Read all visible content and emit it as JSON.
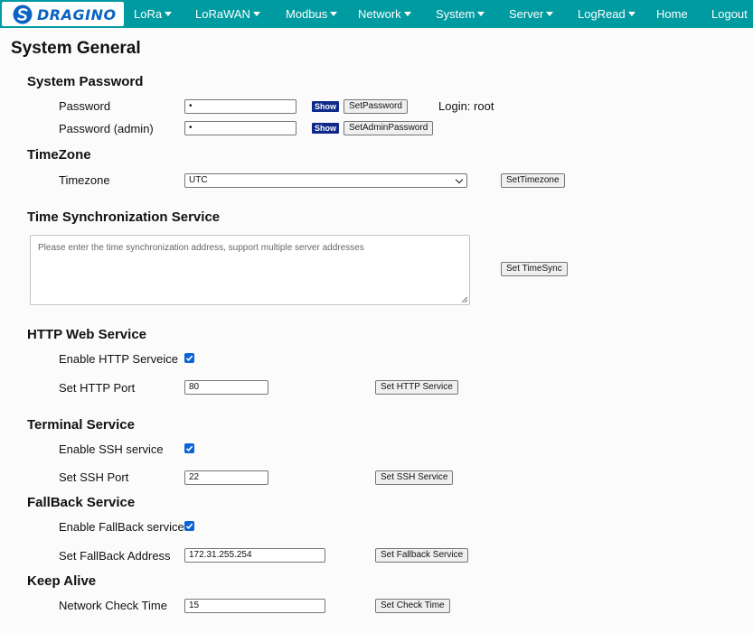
{
  "nav": {
    "logo_text": "DRAGINO",
    "items": [
      {
        "label": "LoRa",
        "dropdown": true
      },
      {
        "label": "LoRaWAN",
        "dropdown": true
      },
      {
        "label": "Modbus",
        "dropdown": true
      },
      {
        "label": "Network",
        "dropdown": true
      },
      {
        "label": "System",
        "dropdown": true
      },
      {
        "label": "Server",
        "dropdown": true
      },
      {
        "label": "LogRead",
        "dropdown": true
      },
      {
        "label": "Home",
        "dropdown": false
      },
      {
        "label": "Logout",
        "dropdown": false
      }
    ]
  },
  "page_title": "System General",
  "password_section": {
    "title": "System Password",
    "password_label": "Password",
    "password_value": "•",
    "show_label": "Show",
    "set_password_label": "SetPassword",
    "login_text": "Login: root",
    "admin_label": "Password (admin)",
    "admin_value": "•",
    "set_admin_label": "SetAdminPassword"
  },
  "timezone_section": {
    "title": "TimeZone",
    "label": "Timezone",
    "selected": "UTC",
    "button": "SetTimezone"
  },
  "timesync_section": {
    "title": "Time Synchronization Service",
    "placeholder": "Please enter the time synchronization address, support multiple server addresses",
    "button": "Set TimeSync"
  },
  "http_section": {
    "title": "HTTP Web Service",
    "enable_label": "Enable HTTP Serveice",
    "enabled": true,
    "port_label": "Set HTTP Port",
    "port_value": "80",
    "button": "Set HTTP Service"
  },
  "terminal_section": {
    "title": "Terminal Service",
    "enable_label": "Enable SSH service",
    "enabled": true,
    "port_label": "Set SSH Port",
    "port_value": "22",
    "button": "Set SSH Service"
  },
  "fallback_section": {
    "title": "FallBack Service",
    "enable_label": "Enable FallBack service",
    "enabled": true,
    "address_label": "Set FallBack Address",
    "address_value": "172.31.255.254",
    "button": "Set Fallback Service"
  },
  "keepalive_section": {
    "title": "Keep Alive",
    "label": "Network Check Time",
    "value": "15",
    "button": "Set Check Time"
  },
  "colors": {
    "nav_bg": "#009ba0",
    "logo_blue": "#0a63c2",
    "show_btn": "#0f2a8a",
    "checkbox": "#0b63d6"
  },
  "icons": [
    "dragino-logo-icon",
    "chevron-down-icon",
    "checkmark-icon",
    "resize-grip-icon"
  ]
}
